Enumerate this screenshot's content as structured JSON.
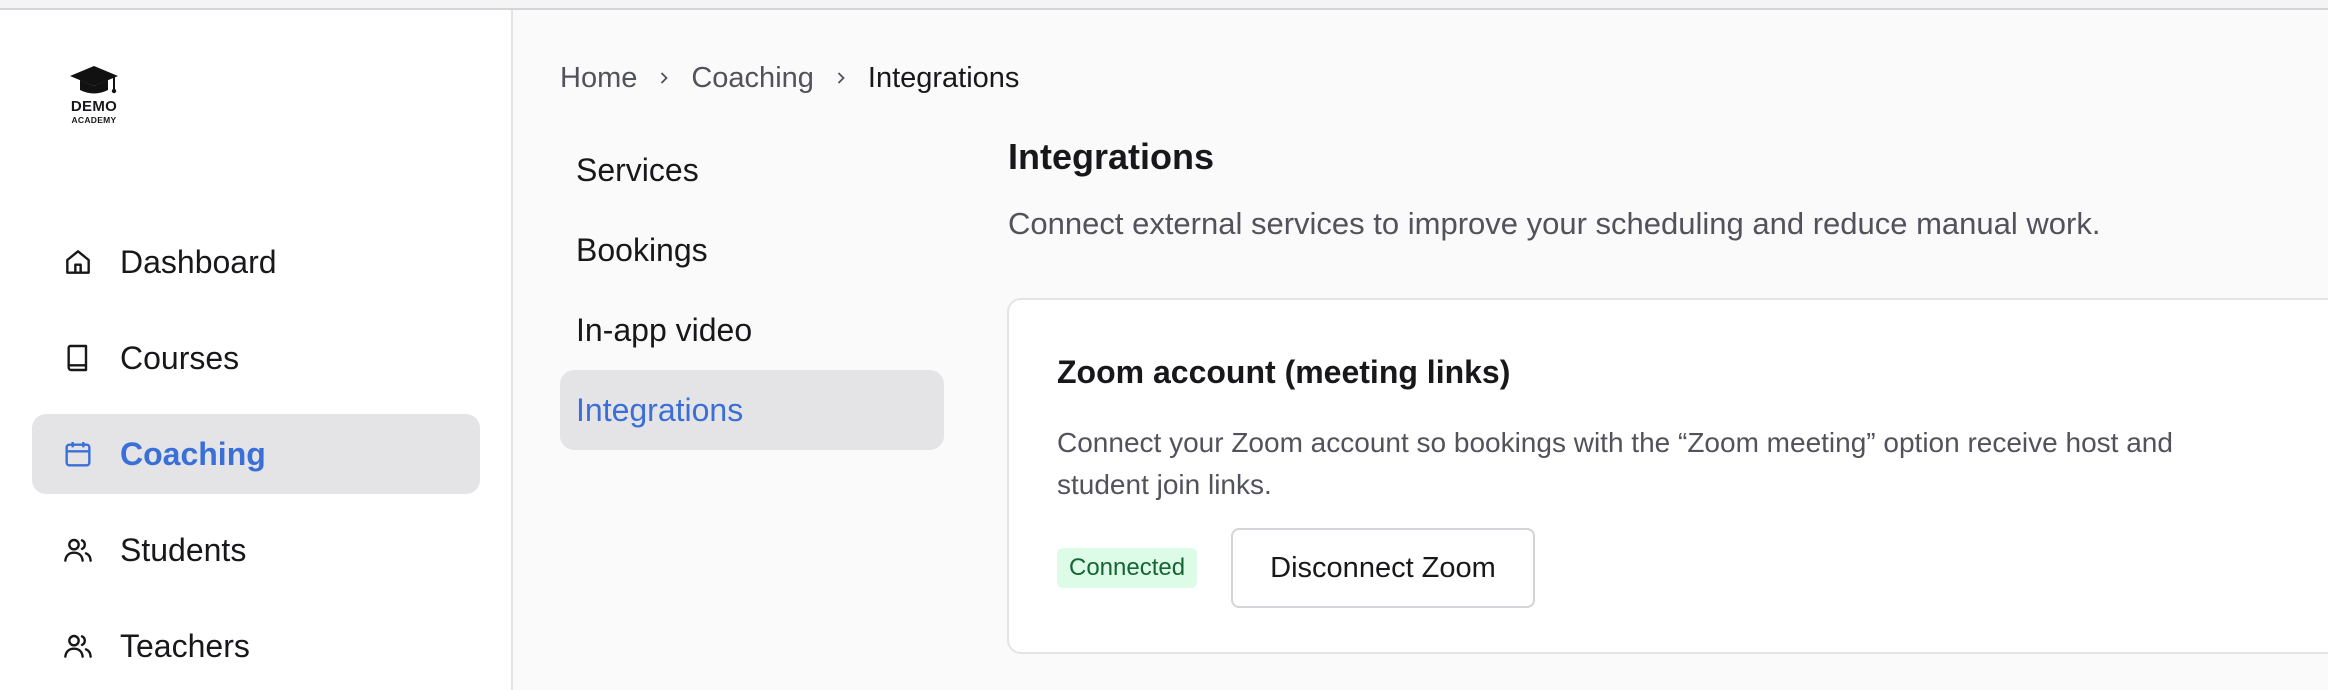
{
  "logo": {
    "line1": "DEMO",
    "line2": "ACADEMY",
    "icon": "graduation-cap-icon"
  },
  "sidebar": {
    "items": [
      {
        "label": "Dashboard",
        "icon": "home-icon",
        "active": false
      },
      {
        "label": "Courses",
        "icon": "book-icon",
        "active": false
      },
      {
        "label": "Coaching",
        "icon": "calendar-icon",
        "active": true
      },
      {
        "label": "Students",
        "icon": "users-icon",
        "active": false
      },
      {
        "label": "Teachers",
        "icon": "users-icon",
        "active": false
      }
    ]
  },
  "breadcrumb": {
    "items": [
      "Home",
      "Coaching",
      "Integrations"
    ],
    "separator_icon": "chevron-right-icon"
  },
  "subnav": {
    "items": [
      {
        "label": "Services",
        "active": false
      },
      {
        "label": "Bookings",
        "active": false
      },
      {
        "label": "In-app video",
        "active": false
      },
      {
        "label": "Integrations",
        "active": true
      }
    ]
  },
  "main": {
    "title": "Integrations",
    "description": "Connect external services to improve your scheduling and reduce manual work.",
    "card": {
      "title": "Zoom account (meeting links)",
      "description": "Connect your Zoom account so bookings with the “Zoom meeting” option receive host and student join links.",
      "status": "Connected",
      "action_label": "Disconnect Zoom"
    }
  },
  "colors": {
    "accent": "#3b6fd8",
    "active_bg": "#e4e4e7",
    "badge_bg": "#dcfce7",
    "badge_text": "#166534"
  }
}
